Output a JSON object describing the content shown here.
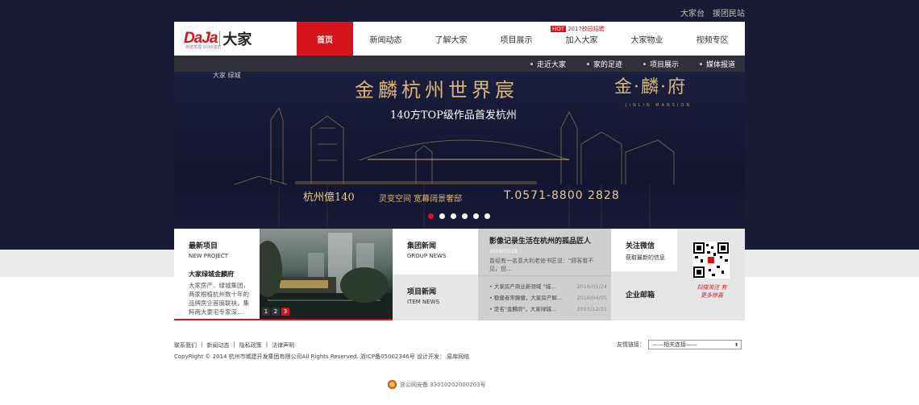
{
  "top_links": [
    "大家台",
    "援团民站"
  ],
  "logo": {
    "brand_en": "DaJa",
    "brand_cn": "大家",
    "tagline": "用建筑理 2016建筑"
  },
  "nav": {
    "items": [
      {
        "label": "首页",
        "active": true
      },
      {
        "label": "新闻动态"
      },
      {
        "label": "了解大家"
      },
      {
        "label": "项目展示"
      },
      {
        "label": "加入大家"
      },
      {
        "label": "大家物业"
      },
      {
        "label": "视频专区"
      }
    ],
    "hot_badge": {
      "tag": "HOT",
      "text": "2017校园招聘"
    }
  },
  "subnav": [
    "走近大家",
    "家的足迹",
    "项目展示",
    "媒体报道"
  ],
  "banner": {
    "brand_mini": "大家 绿城",
    "title": "金麟杭州世界宸",
    "subtitle": "140方TOP级作品首发杭州",
    "logo_cn": "金·麟·府",
    "logo_en": "JINLIN MANSION",
    "bottom_left": "杭州億140",
    "bottom_mid": "灵变空间 宽幕阔景奢邸",
    "phone": "T.0571-8800 2828",
    "slide_count": 6,
    "active_slide": 0
  },
  "project": {
    "title": "最新项目",
    "title_en": "NEW PROJECT",
    "name": "大家绿城金麟府",
    "desc": "大家房产、绿城集团，两家根植杭州数十年的品牌房企首度联袂，集粹两大豪宅专家深...",
    "pages": [
      "1",
      "2",
      "3"
    ],
    "active_page": 2
  },
  "news_tabs": [
    {
      "title": "集团新闻",
      "title_en": "GROUP NEWS"
    },
    {
      "title": "项目新闻",
      "title_en": "ITEM NEWS"
    }
  ],
  "news": {
    "headline": "影像记录生活在杭州的孤品匠人",
    "date": "2016/07/29",
    "summary": "曾经有一名意大利老修书匠说：\"顾客看不见，但...",
    "items": [
      {
        "title": "大家房产商业新领域 \"城...",
        "date": "2016/05/24"
      },
      {
        "title": "稳健者常臆健，大家房产解...",
        "date": "2016/04/05"
      },
      {
        "title": "定名\"金麟府\"，大家绿城...",
        "date": "2015/12/31"
      }
    ]
  },
  "wechat": {
    "title": "关注微信",
    "sub": "获取最新的信息",
    "mail": "企业邮箱"
  },
  "qr_text": "扫描关注 有更多惊喜",
  "footer": {
    "links": [
      "联系我们",
      "新闻动态",
      "隐私政策",
      "法律声明"
    ],
    "separator": "|",
    "copyright": "CopyRight © 2014 杭州市城建开发集团有限公司All Rights Reserved. 浙ICP备05002346号 设计开发： 易库网络",
    "friend_label": "友情链接：",
    "friend_select": "——相关连接——",
    "police": "浙公网安备 33010202000203号"
  },
  "colors": {
    "accent": "#d7141b",
    "banner_bg": "#181a36",
    "subnav_bg": "#2f3039"
  }
}
